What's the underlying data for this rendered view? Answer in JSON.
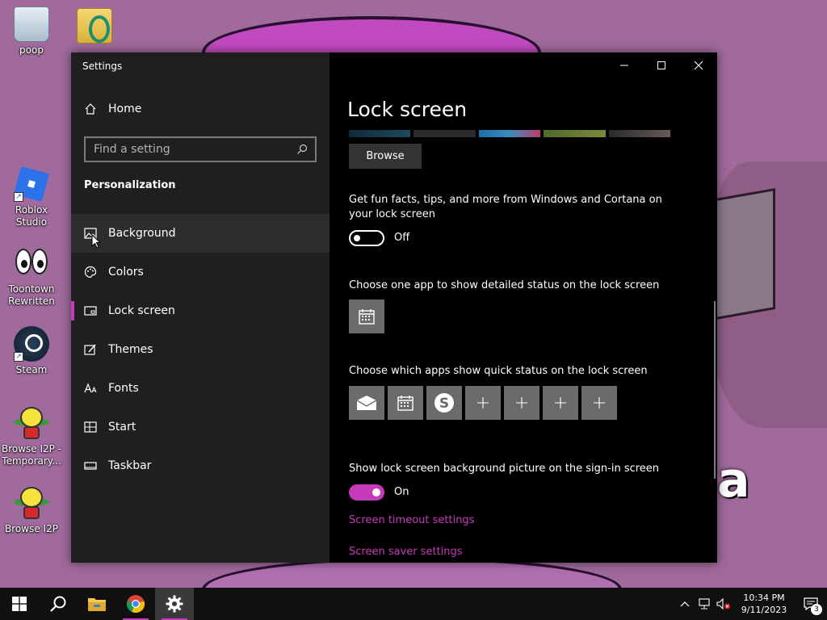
{
  "desktop": {
    "icons": [
      {
        "label": "poop",
        "icon": "recycle-bin-icon"
      },
      {
        "label": "",
        "icon": "folder-icon"
      },
      {
        "label": "Roblox Studio",
        "icon": "roblox-studio-icon"
      },
      {
        "label": "Toontown Rewritten",
        "icon": "toontown-icon"
      },
      {
        "label": "Steam",
        "icon": "steam-icon"
      },
      {
        "label": "Browse I2P - Temporary...",
        "icon": "i2p-icon"
      },
      {
        "label": "Browse I2P",
        "icon": "i2p-icon"
      }
    ],
    "wallpaper_text": "a"
  },
  "window": {
    "title": "Settings",
    "controls": [
      "minimize",
      "maximize",
      "close"
    ],
    "sidebar": {
      "home_label": "Home",
      "search_placeholder": "Find a setting",
      "section_title": "Personalization",
      "items": [
        {
          "label": "Background",
          "icon": "picture-icon",
          "state": "hover"
        },
        {
          "label": "Colors",
          "icon": "palette-icon",
          "state": ""
        },
        {
          "label": "Lock screen",
          "icon": "lock-screen-icon",
          "state": "active"
        },
        {
          "label": "Themes",
          "icon": "themes-icon",
          "state": ""
        },
        {
          "label": "Fonts",
          "icon": "fonts-icon",
          "state": ""
        },
        {
          "label": "Start",
          "icon": "start-icon",
          "state": ""
        },
        {
          "label": "Taskbar",
          "icon": "taskbar-icon",
          "state": ""
        }
      ]
    },
    "content": {
      "title": "Lock screen",
      "browse_label": "Browse",
      "fun_facts_label": "Get fun facts, tips, and more from Windows and Cortana on your lock screen",
      "fun_facts_state": "Off",
      "detailed_status_label": "Choose one app to show detailed status on the lock screen",
      "quick_status_label": "Choose which apps show quick status on the lock screen",
      "quick_status_apps": [
        "mail-icon",
        "calendar-icon",
        "skype-icon",
        "add-icon",
        "add-icon",
        "add-icon",
        "add-icon"
      ],
      "signin_bg_label": "Show lock screen background picture on the sign-in screen",
      "signin_bg_state": "On",
      "link_timeout": "Screen timeout settings",
      "link_saver": "Screen saver settings"
    }
  },
  "taskbar": {
    "time": "10:34 PM",
    "date": "9/11/2023",
    "notification_count": "3"
  },
  "colors": {
    "accent": "#c639b9",
    "sidebar_bg": "#1f1f1f",
    "content_bg": "#000000",
    "tile_bg": "#6b6b6b"
  }
}
